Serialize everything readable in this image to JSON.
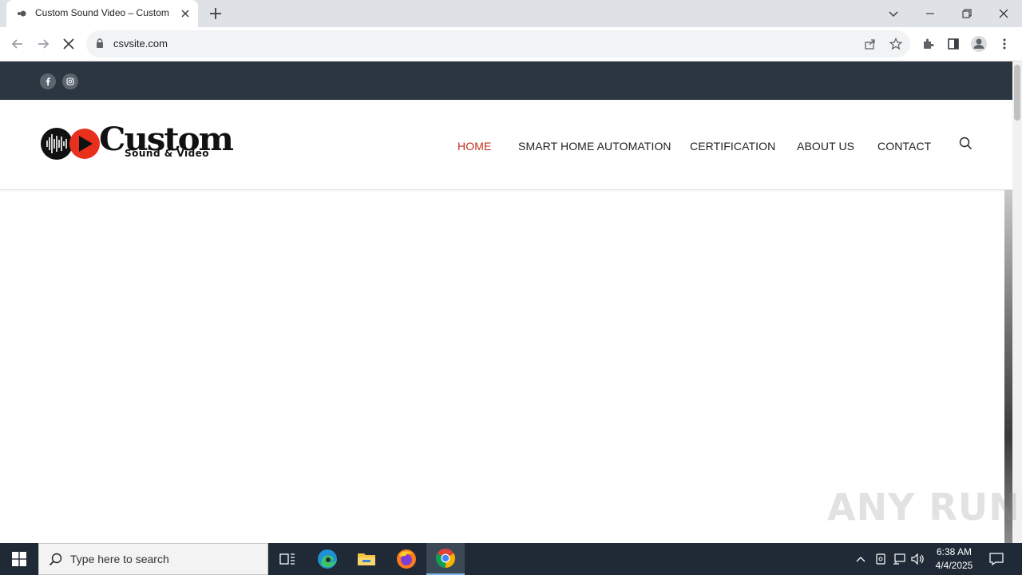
{
  "browser": {
    "tab_title": "Custom Sound Video – Custom",
    "url": "csvsite.com",
    "icons": [
      "back-arrow-icon",
      "forward-arrow-icon",
      "stop-loading-icon",
      "lock-icon",
      "share-icon",
      "star-icon",
      "extensions-icon",
      "side-panel-icon",
      "profile-icon",
      "menu-icon",
      "tab-search-icon",
      "minimize-icon",
      "restore-icon",
      "close-icon"
    ]
  },
  "site": {
    "social_icons": [
      "facebook-icon",
      "instagram-icon"
    ],
    "logo": {
      "main": "Custom",
      "sub": "Sound & Video"
    },
    "nav": [
      {
        "label": "HOME",
        "active": true
      },
      {
        "label": "SMART HOME AUTOMATION",
        "active": false
      },
      {
        "label": "CERTIFICATION",
        "active": false
      },
      {
        "label": "ABOUT US",
        "active": false
      },
      {
        "label": "CONTACT",
        "active": false
      }
    ],
    "accent_color": "#c0301e",
    "topbar_color": "#2b3640"
  },
  "watermark": "ANY RUN",
  "taskbar": {
    "search_placeholder": "Type here to search",
    "time": "6:38 AM",
    "date": "4/4/2025",
    "apps": [
      "task-view-icon",
      "edge-icon",
      "file-explorer-icon",
      "firefox-icon",
      "chrome-icon"
    ]
  }
}
